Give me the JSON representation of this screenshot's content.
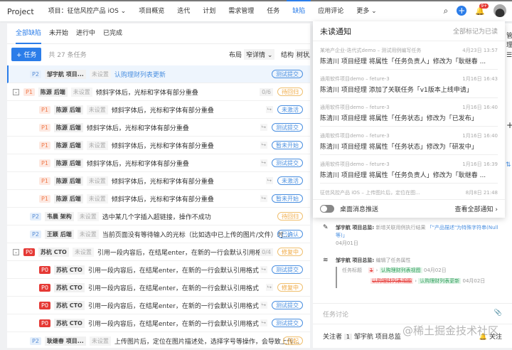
{
  "nav": {
    "brand": "Project",
    "project": "项目：征信风控产品 iOS ⌄",
    "items": [
      "项目概览",
      "迭代",
      "计划",
      "需求管理",
      "任务",
      "缺陷",
      "应用评论",
      "更多 ⌄"
    ],
    "active": 5,
    "badge": "9+"
  },
  "tabs": [
    "全部缺陷",
    "未开始",
    "进行中",
    "已完成"
  ],
  "toolbar": {
    "add": "+ 任务",
    "count": "共 27 条任务",
    "layout_label": "布局",
    "layout_value": "窄详情 ⌄",
    "struct_label": "结构",
    "struct_value": "树状展"
  },
  "unset": "未设置",
  "rows": [
    {
      "p": "P2",
      "who": "邹宇航 项目...",
      "unset": true,
      "title": "认购理财列表更新",
      "status": "测试提交",
      "color": "blue",
      "hl": true,
      "link": true
    },
    {
      "p": "P1",
      "who": "陈源 后端",
      "unset": true,
      "title": "倾斜字体后，光标和字体有部分重叠",
      "status": "待回归",
      "color": "orange",
      "exp": true,
      "count": "0/6"
    },
    {
      "p": "P1",
      "who": "陈源 后端",
      "unset": true,
      "title": "倾斜字体后，光标和字体有部分重叠",
      "status": "未激活",
      "color": "blue",
      "child": true
    },
    {
      "p": "P1",
      "who": "陈源 后端",
      "unset": false,
      "title": "倾斜字体后，光标和字体有部分重叠",
      "status": "测试提交",
      "color": "blue",
      "child": true
    },
    {
      "p": "P1",
      "who": "陈源 后端",
      "unset": true,
      "title": "倾斜字体后，光标和字体有部分重叠",
      "status": "暂未开始",
      "color": "blue",
      "child": true
    },
    {
      "p": "P1",
      "who": "陈源 后端",
      "unset": false,
      "title": "倾斜字体后，光标和字体有部分重叠",
      "status": "测试提交",
      "color": "blue",
      "child": true
    },
    {
      "p": "P1",
      "who": "陈源 后端",
      "unset": true,
      "title": "倾斜字体后，光标和字体有部分重叠",
      "status": "未激活",
      "color": "blue",
      "child": true
    },
    {
      "p": "P1",
      "who": "陈源 后端",
      "unset": true,
      "title": "倾斜字体后，光标和字体有部分重叠",
      "status": "暂未开始",
      "color": "blue",
      "child": true
    },
    {
      "p": "P2",
      "who": "韦晨 架构",
      "unset": true,
      "title": "选中某几个字插入超链接，操作不成功",
      "status": "待回归",
      "color": "orange"
    },
    {
      "p": "P2",
      "who": "王颖 后端",
      "unset": true,
      "title": "当前页面没有等待输入的光标（比如选中已上传的图片/文件）时...",
      "status": "已确认",
      "color": "blue"
    },
    {
      "p": "P0",
      "who": "苏杭 CTO",
      "unset": true,
      "title": "引用一段内容后，在结尾enter，在新的一行会默认引用格式",
      "status": "修复中",
      "color": "orange",
      "exp": true,
      "count": "0/4"
    },
    {
      "p": "P0",
      "who": "苏杭 CTO",
      "unset": false,
      "title": "引用一段内容后，在结尾enter，在新的一行会默认引用格式",
      "status": "测试提交",
      "color": "blue",
      "child": true
    },
    {
      "p": "P0",
      "who": "苏杭 CTO",
      "unset": false,
      "title": "引用一段内容后，在结尾enter，在新的一行会默认引用格式",
      "status": "修复中",
      "color": "orange",
      "child": true
    },
    {
      "p": "P0",
      "who": "苏杭 CTO",
      "unset": false,
      "title": "引用一段内容后，在结尾enter，在新的一行会默认引用格式",
      "status": "测试提交",
      "color": "blue",
      "child": true
    },
    {
      "p": "P0",
      "who": "苏杭 CTO",
      "unset": false,
      "title": "引用一段内容后，在结尾enter，在新的一行会默认引用格式",
      "status": "测试提交",
      "color": "blue",
      "child": true
    },
    {
      "p": "P2",
      "who": "耿继春 项目...",
      "unset": true,
      "title": "上传图片后，定位在图片描述处，选择字号等操作，会导致上传...",
      "status": "挂起",
      "color": "orange"
    }
  ],
  "popover": {
    "title": "未读通知",
    "mark_all": "全部标记为已读",
    "notes": [
      {
        "src": "某地产企业-迭代式demo – 测试用例编写任务",
        "time": "4月23日 13:57",
        "text": "陈清川 项目经理 将属性「任务负责人」修改为「耿继春 ..."
      },
      {
        "src": "通用软件项目demo – feture-3",
        "time": "1月16日 16:43",
        "text": "陈清川 项目经理 添加了关联任务「v1版本上线申请」"
      },
      {
        "src": "通用软件项目demo – feture-3",
        "time": "1月16日 16:40",
        "text": "陈清川 项目经理 将属性「任务状态」修改为「已发布」"
      },
      {
        "src": "通用软件项目demo – feture-3",
        "time": "1月16日 16:40",
        "text": "陈清川 项目经理 将属性「任务状态」修改为「研发中」"
      },
      {
        "src": "通用软件项目demo – feture-3",
        "time": "1月16日 16:39",
        "text": "陈清川 项目经理 将属性「任务负责人」修改为「耿继春 ..."
      },
      {
        "src": "征信风控产品 iOS – 上传图片后，定位在图...",
        "time": "8月8日 21:48",
        "text": ""
      }
    ],
    "push": "桌面消息推送",
    "view_all": "查看全部通知 ›"
  },
  "edge": {
    "manage": "管理"
  },
  "detail": {
    "a1_user": "邹宇航 项目总监:",
    "a1_text": "新增关联用例执行结果",
    "a1_link": "「\"产品描述\"为特殊字符串(Null等)」",
    "a1_date": "04月01日",
    "a2_user": "邹宇航 项目总监:",
    "a2_text": "编辑了任务属性",
    "field": "任务标题",
    "old1": "1",
    "new1": "认购理财列表视图",
    "d1": "04月02日",
    "old2": "认购理财列表视图",
    "new2": "认购理财列表更新",
    "d2": "04月02日",
    "discuss": "任务讨论",
    "followers": "关注者",
    "fcount": "1",
    "follower": "邹宇航 项目总监",
    "follow": "关注"
  },
  "watermark": "@稀土掘金技术社区"
}
